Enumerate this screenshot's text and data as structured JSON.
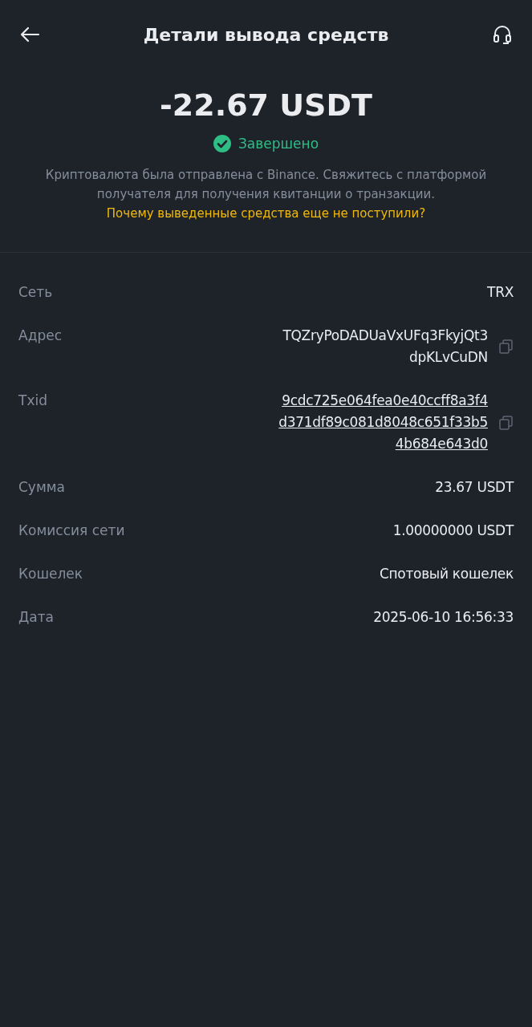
{
  "header": {
    "title": "Детали вывода средств"
  },
  "amount": "-22.67 USDT",
  "status": {
    "label": "Завершено",
    "completed": true
  },
  "description": "Криптовалюта была отправлена с Binance. Свяжитесь с платформой получателя для получения квитанции о транзакции.",
  "help_link": "Почему выведенные средства еще не поступили?",
  "details": [
    {
      "label": "Сеть",
      "kind": "text",
      "lines": [
        "TRX"
      ]
    },
    {
      "label": "Адрес",
      "kind": "copy",
      "lines": [
        "TQZryPoDADUaVxUFq3FkyjQt3",
        "dpKLvCuDN"
      ]
    },
    {
      "label": "Txid",
      "kind": "link_copy",
      "lines": [
        "9cdc725e064fea0e40ccff8a3f4",
        "d371df89c081d8048c651f33b5",
        "4b684e643d0"
      ]
    },
    {
      "label": "Сумма",
      "kind": "text",
      "lines": [
        "23.67 USDT"
      ]
    },
    {
      "label": "Комиссия сети",
      "kind": "text",
      "lines": [
        "1.00000000 USDT"
      ]
    },
    {
      "label": "Кошелек",
      "kind": "text",
      "lines": [
        "Спотовый кошелек"
      ]
    },
    {
      "label": "Дата",
      "kind": "text",
      "lines": [
        "2025-06-10 16:56:33"
      ]
    }
  ]
}
